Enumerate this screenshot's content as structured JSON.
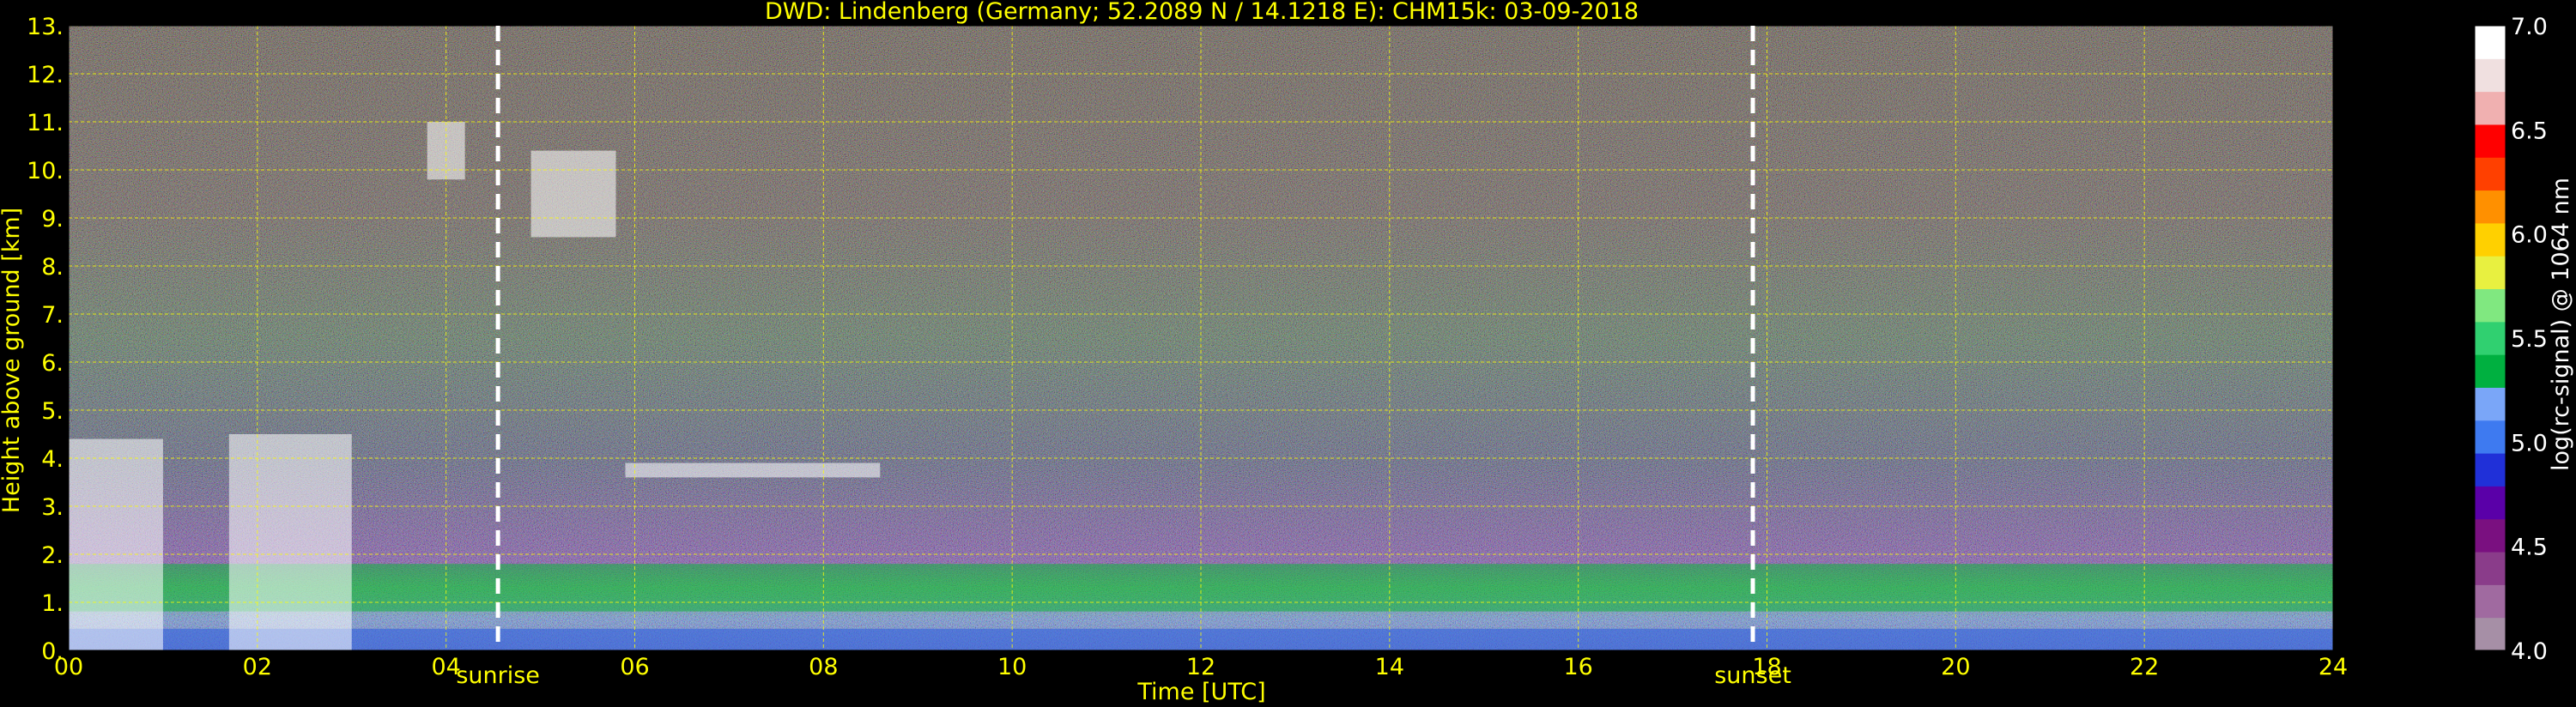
{
  "chart_data": {
    "type": "heatmap",
    "title": "DWD: Lindenberg (Germany; 52.2089 N / 14.1218 E):    CHM15k: 03-09-2018",
    "xlabel": "Time [UTC]",
    "ylabel": "Height above ground [km]",
    "xlim": [
      0,
      24
    ],
    "ylim": [
      0,
      13
    ],
    "x_ticks": [
      0,
      2,
      4,
      6,
      8,
      10,
      12,
      14,
      16,
      18,
      20,
      22,
      24
    ],
    "x_tick_labels": [
      "00",
      "02",
      "04",
      "06",
      "08",
      "10",
      "12",
      "14",
      "16",
      "18",
      "20",
      "22",
      "24"
    ],
    "y_ticks": [
      0,
      1,
      2,
      3,
      4,
      5,
      6,
      7,
      8,
      9,
      10,
      11,
      12,
      13
    ],
    "y_tick_labels": [
      "0.",
      "1.",
      "2.",
      "3.",
      "4.",
      "5.",
      "6.",
      "7.",
      "8.",
      "9.",
      "10.",
      "11.",
      "12.",
      "13."
    ],
    "grid": true,
    "events": [
      {
        "label": "sunrise",
        "time": 4.55
      },
      {
        "label": "sunset",
        "time": 17.85
      }
    ],
    "colorbar": {
      "label": "log(rc-signal) @ 1064 nm",
      "range": [
        4.0,
        7.0
      ],
      "ticks": [
        4.0,
        4.5,
        5.0,
        5.5,
        6.0,
        6.5,
        7.0
      ],
      "tick_labels": [
        "4.0",
        "4.5",
        "5.0",
        "5.5",
        "6.0",
        "6.5",
        "7.0"
      ],
      "colors": [
        "#a68fa6",
        "#a06aa0",
        "#8a3c8a",
        "#7a1080",
        "#5a00a8",
        "#2030d8",
        "#3e7af0",
        "#7aa6f8",
        "#00b040",
        "#30d070",
        "#80e880",
        "#e8f040",
        "#ffd000",
        "#ff9000",
        "#ff4000",
        "#ff0000",
        "#f0b0b0",
        "#f0e0e0",
        "#ffffff"
      ]
    },
    "features": {
      "boundary_layer_top_km": 1.8,
      "clouds": [
        {
          "t0": 0.0,
          "t1": 1.0,
          "h0": 0.0,
          "h1": 4.4
        },
        {
          "t0": 1.7,
          "t1": 3.0,
          "h0": 0.0,
          "h1": 4.5
        },
        {
          "t0": 3.8,
          "t1": 4.2,
          "h0": 9.8,
          "h1": 11.0
        },
        {
          "t0": 4.9,
          "t1": 5.8,
          "h0": 8.6,
          "h1": 10.4
        },
        {
          "t0": 5.9,
          "t1": 8.6,
          "h0": 3.6,
          "h1": 3.9
        }
      ]
    }
  },
  "colors": {
    "text": "#ffff00",
    "grid": "#ffff00",
    "background": "#000000"
  }
}
